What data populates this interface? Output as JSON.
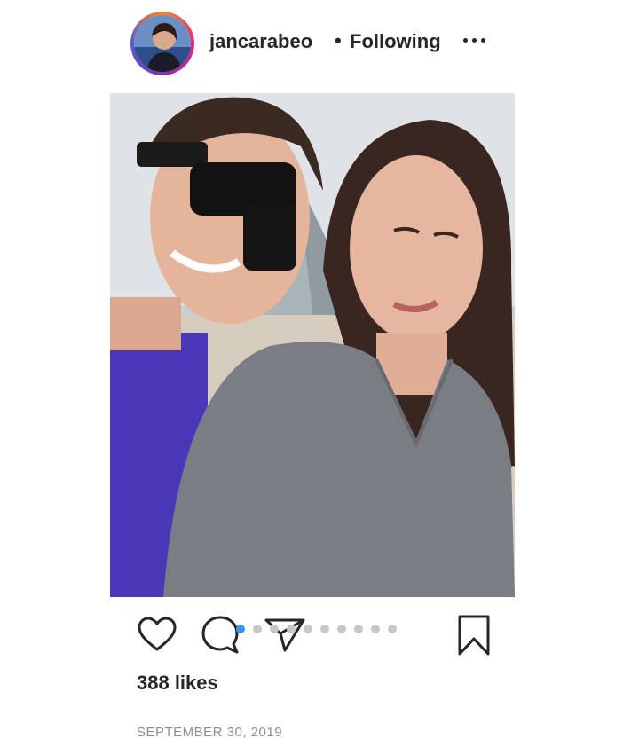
{
  "post": {
    "username": "jancarabeo",
    "separator": "•",
    "follow_status": "Following",
    "likes": "388 likes",
    "date": "SEPTEMBER 30, 2019"
  },
  "carousel": {
    "total_slides": 10,
    "active_index": 0
  },
  "icons": {
    "more": "more-options-icon",
    "next": "chevron-right-icon",
    "like": "heart-icon",
    "comment": "comment-icon",
    "share": "paper-plane-icon",
    "save": "bookmark-icon"
  },
  "colors": {
    "text": "#262626",
    "muted": "#8e8e8e",
    "active_dot": "#3897f0",
    "inactive_dot": "#c7c7c7"
  }
}
